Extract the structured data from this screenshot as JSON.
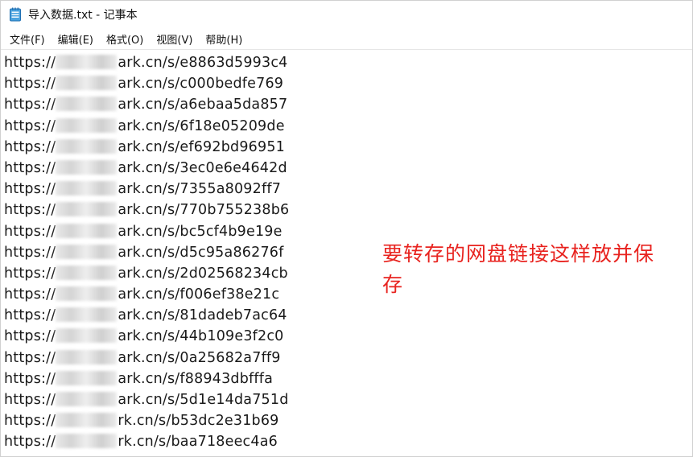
{
  "window": {
    "title": "导入数据.txt - 记事本"
  },
  "menu": {
    "items": [
      {
        "label": "文件(F)"
      },
      {
        "label": "编辑(E)"
      },
      {
        "label": "格式(O)"
      },
      {
        "label": "视图(V)"
      },
      {
        "label": "帮助(H)"
      }
    ]
  },
  "editor": {
    "lines": [
      {
        "prefix": "https://",
        "suffix": "ark.cn/s/e8863d5993c4"
      },
      {
        "prefix": "https://",
        "suffix": "ark.cn/s/c000bedfe769"
      },
      {
        "prefix": "https://",
        "suffix": "ark.cn/s/a6ebaa5da857"
      },
      {
        "prefix": "https://",
        "suffix": "ark.cn/s/6f18e05209de"
      },
      {
        "prefix": "https://",
        "suffix": "ark.cn/s/ef692bd96951"
      },
      {
        "prefix": "https://",
        "suffix": "ark.cn/s/3ec0e6e4642d"
      },
      {
        "prefix": "https://",
        "suffix": "ark.cn/s/7355a8092ff7"
      },
      {
        "prefix": "https://",
        "suffix": "ark.cn/s/770b755238b6"
      },
      {
        "prefix": "https://",
        "suffix": "ark.cn/s/bc5cf4b9e19e"
      },
      {
        "prefix": "https://",
        "suffix": "ark.cn/s/d5c95a86276f"
      },
      {
        "prefix": "https://",
        "suffix": "ark.cn/s/2d02568234cb"
      },
      {
        "prefix": "https://",
        "suffix": "ark.cn/s/f006ef38e21c"
      },
      {
        "prefix": "https://",
        "suffix": "ark.cn/s/81dadeb7ac64"
      },
      {
        "prefix": "https://",
        "suffix": "ark.cn/s/44b109e3f2c0"
      },
      {
        "prefix": "https://",
        "suffix": "ark.cn/s/0a25682a7ff9"
      },
      {
        "prefix": "https://",
        "suffix": "ark.cn/s/f88943dbfffa"
      },
      {
        "prefix": "https://",
        "suffix": "ark.cn/s/5d1e14da751d"
      },
      {
        "prefix": "https://",
        "suffix": "rk.cn/s/b53dc2e31b69"
      },
      {
        "prefix": "https://",
        "suffix": "rk.cn/s/baa718eec4a6"
      }
    ]
  },
  "annotation": {
    "text": "要转存的网盘链接这样放并保存",
    "color": "#e8231f"
  },
  "icons": {
    "app": "notepad-icon"
  }
}
